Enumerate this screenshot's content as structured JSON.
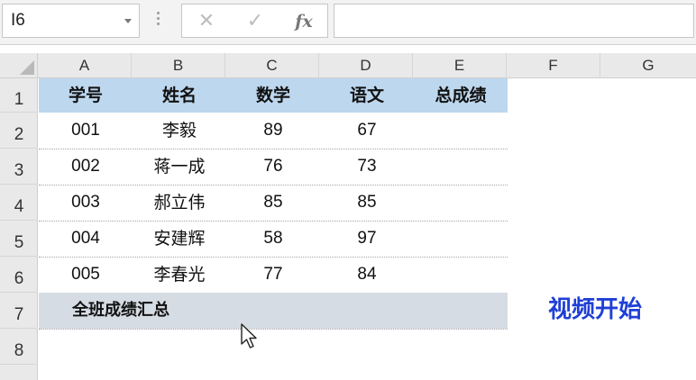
{
  "formula_bar": {
    "name_box_value": "I6",
    "cancel_glyph": "✕",
    "enter_glyph": "✓",
    "fx_label": "fx",
    "formula_value": ""
  },
  "columns": [
    "A",
    "B",
    "C",
    "D",
    "E",
    "F",
    "G"
  ],
  "rows": [
    "1",
    "2",
    "3",
    "4",
    "5",
    "6",
    "7",
    "8"
  ],
  "table": {
    "headers": [
      "学号",
      "姓名",
      "数学",
      "语文",
      "总成绩"
    ],
    "records": [
      [
        "001",
        "李毅",
        "89",
        "67",
        ""
      ],
      [
        "002",
        "蒋一成",
        "76",
        "73",
        ""
      ],
      [
        "003",
        "郝立伟",
        "85",
        "85",
        ""
      ],
      [
        "004",
        "安建辉",
        "58",
        "97",
        ""
      ],
      [
        "005",
        "李春光",
        "77",
        "84",
        ""
      ]
    ],
    "summary_label": "全班成绩汇总"
  },
  "overlay_label": "视频开始",
  "colors": {
    "header_fill": "#bdd7ee",
    "summary_fill": "#d6dce4",
    "overlay_text": "#1f3fd6"
  }
}
